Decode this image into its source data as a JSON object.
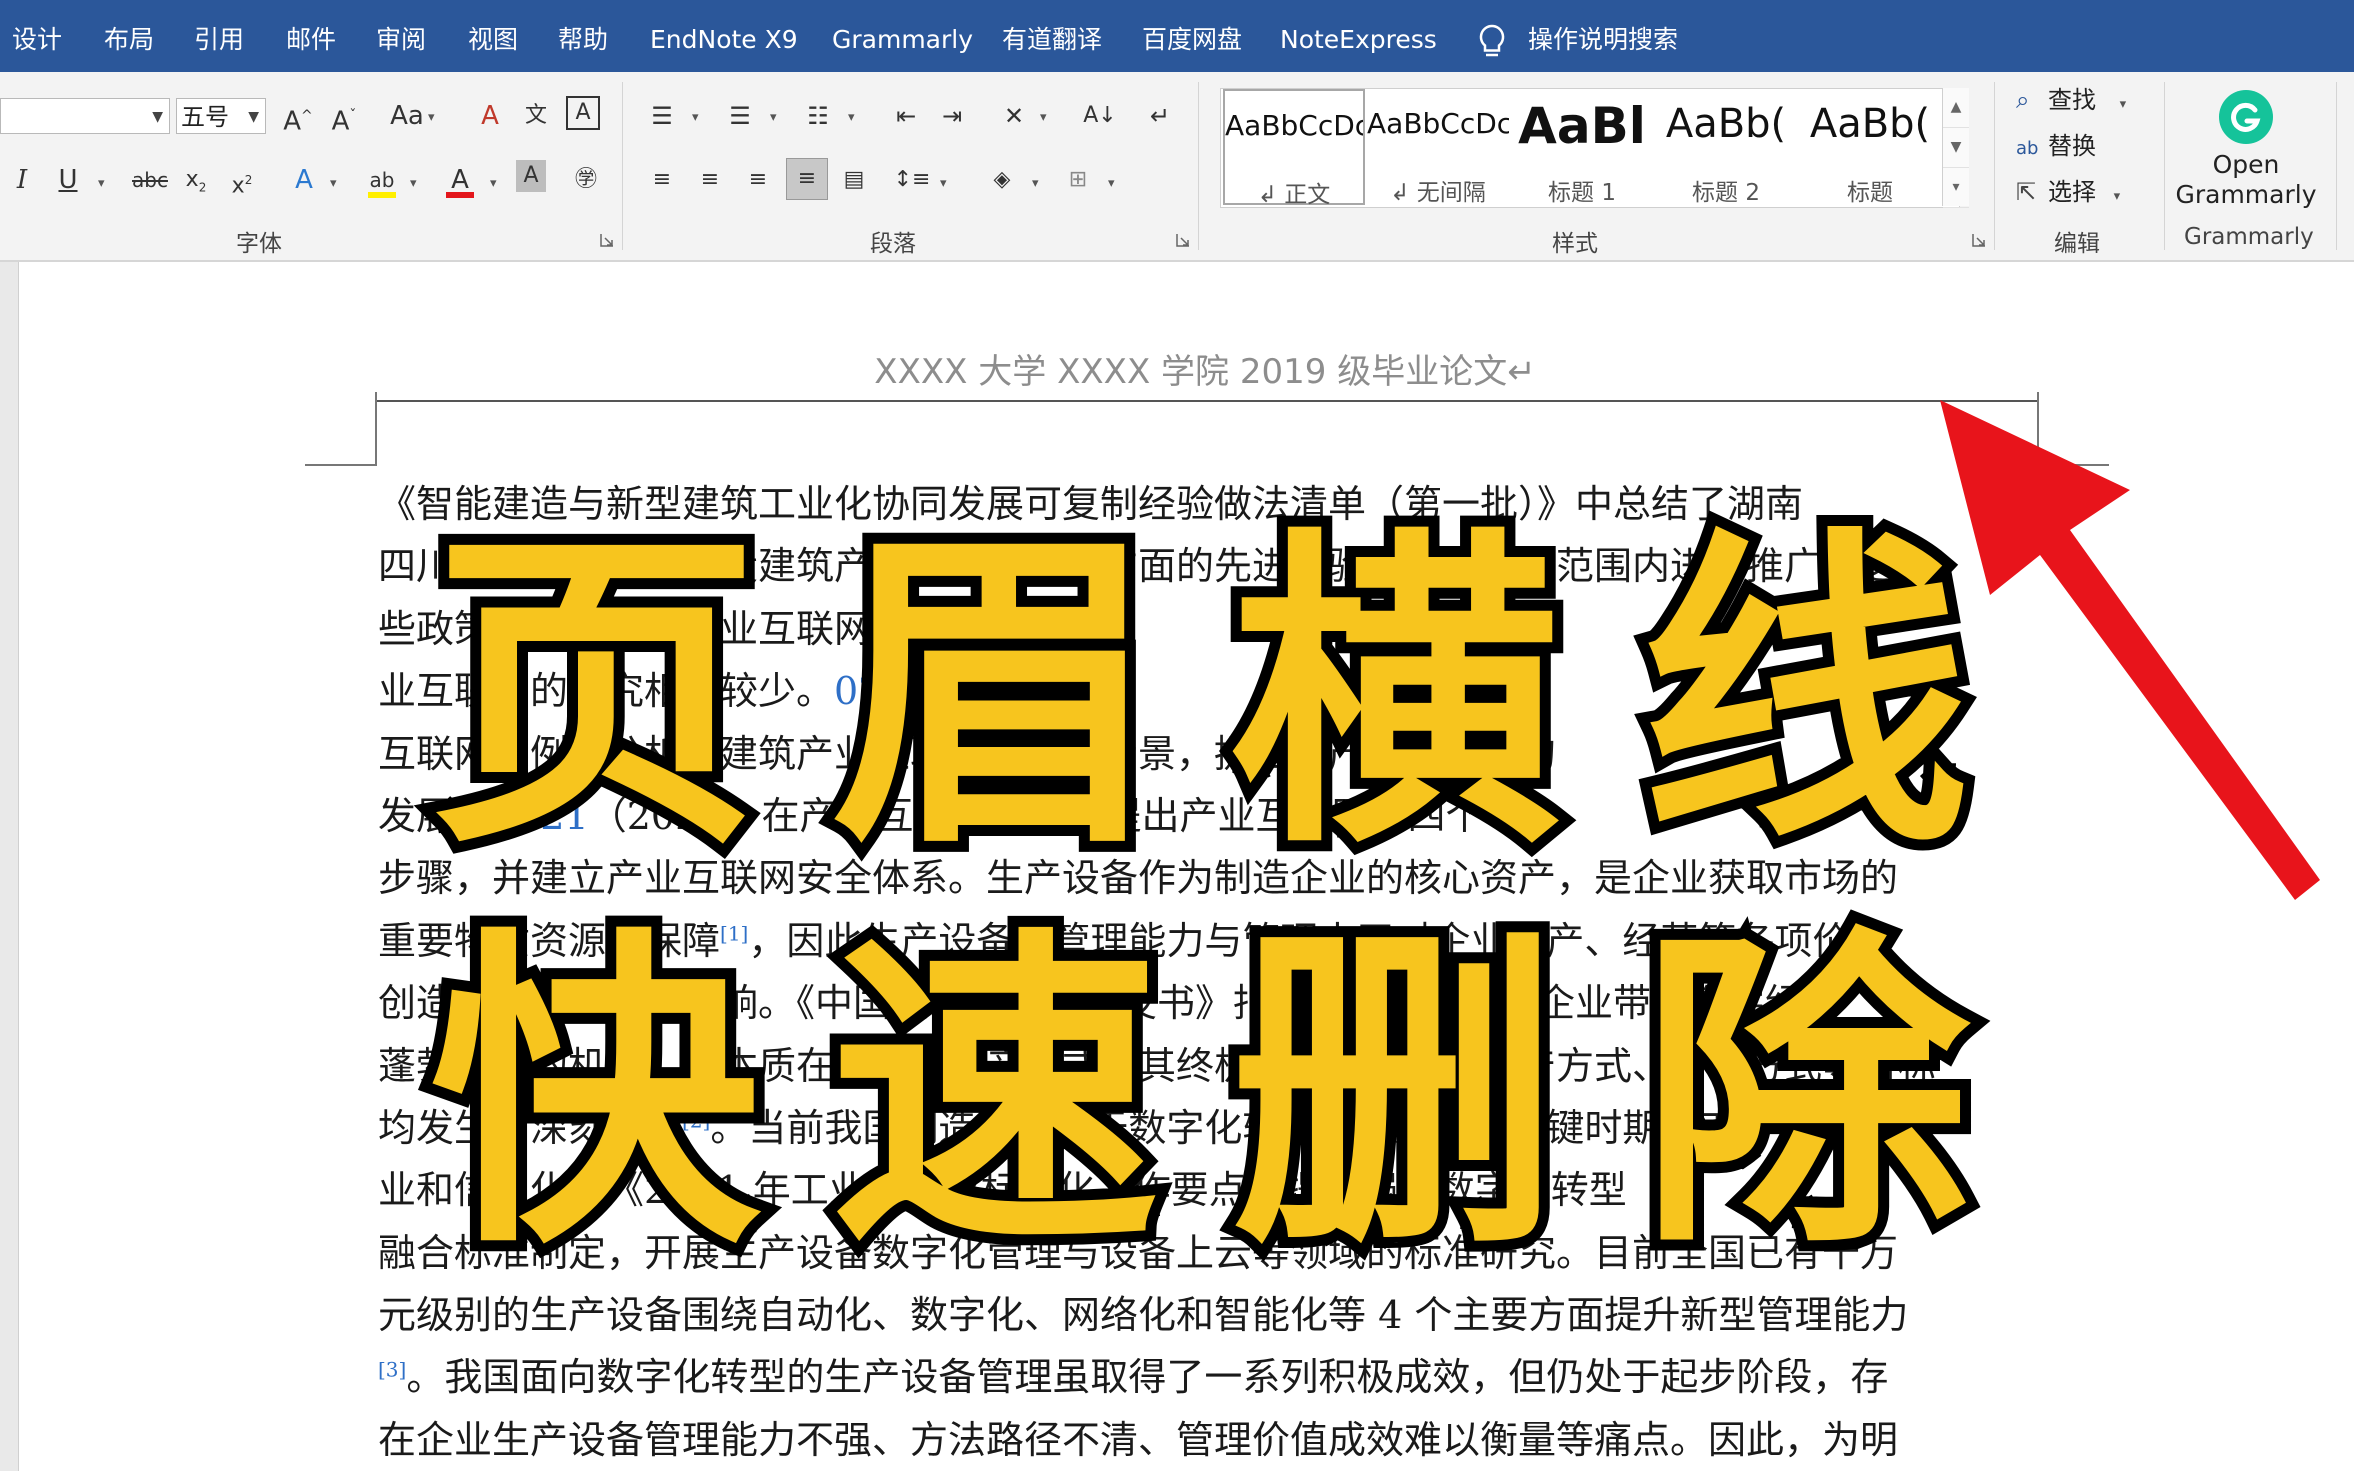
{
  "menu": {
    "items": [
      "设计",
      "布局",
      "引用",
      "邮件",
      "审阅",
      "视图",
      "帮助",
      "EndNote X9",
      "Grammarly",
      "有道翻译",
      "百度网盘",
      "NoteExpress"
    ],
    "search_label": "操作说明搜索"
  },
  "ribbon": {
    "font_name": "",
    "font_size": "五号",
    "groups": {
      "font": "字体",
      "paragraph": "段落",
      "styles": "样式",
      "editing": "编辑",
      "grammarly": "Grammarly"
    },
    "styles": [
      {
        "sample": "AaBbCcDc",
        "name": "正文",
        "mark": "↲"
      },
      {
        "sample": "AaBbCcDc",
        "name": "无间隔",
        "mark": "↲"
      },
      {
        "sample": "AaBl",
        "name": "标题 1"
      },
      {
        "sample": "AaBb(",
        "name": "标题 2"
      },
      {
        "sample": "AaBb(",
        "name": "标题"
      }
    ],
    "editing": {
      "find": "查找",
      "replace": "替换",
      "select": "选择"
    },
    "grammarly": {
      "open_line1": "Open",
      "open_line2": "Grammarly"
    }
  },
  "colors": {
    "menubar": "#2b579a",
    "overlay_fill": "#f7c51e",
    "arrow": "#e8141b",
    "link": "#2e6fc7"
  },
  "document": {
    "header": "XXXX 大学 XXXX 学院 2019 级毕业论文↵",
    "lines": [
      [
        "《智能建造与新型建筑工业化协同发展可复制经验做法清单（第一批）》中总结了湖南"
      ],
      [
        "四川省、广东省在建设建筑产业互联网平台方面的先进经验，并在全国范围内进行推广，这"
      ],
      [
        "些政策为我国建筑产业互联网平台的建设按"
      ],
      [
        "业互联网的研究相对较少。",
        {
          "link": "020"
        },
        "）从"
      ],
      [
        "互联网为例，分析了建筑产业互联网的应用场景，提出了产业互联网的"
      ],
      [
        "发展",
        {
          "link": "（2021"
        },
        "（2021）在产业互联网发展中提出产业互联网的四个"
      ],
      [
        "步骤，并建立产业互联网安全体系。生产设备作为制造企业的核心资产，是企业获取市场的"
      ],
      [
        "重要物质资源与保障",
        {
          "sup": "[1]"
        },
        "，因此生产设备的管理能力与管理水平对企业生产、经营等各项价值"
      ],
      [
        "创造活动具有重要影响。《中国数字化转型白皮书》指出数字化转型为企业带来数字经济"
      ],
      [
        "蓬勃发展的机遇，其本质在于转变生产方式，其终极目的在于转变生产方式、管理方式等目标"
      ],
      [
        "均发生了深刻变化",
        {
          "sup": "[2]"
        },
        "。当前我国制造业正处于数字化转型步伐加快的关键时期，工"
      ],
      [
        "业和信息化部《2021 年工业通信业标准化工作要点》提出强化数字化转型"
      ],
      [
        "融合标准制定，开展生产设备数字化管理与设备上云等领域的标准研究。目前全国已有千万"
      ],
      [
        "元级别的生产设备围绕自动化、数字化、网络化和智能化等 4 个主要方面提升新型管理能力"
      ],
      [
        {
          "sup": "[3]"
        },
        "。我国面向数字化转型的生产设备管理虽取得了一系列积极成效，但仍处于起步阶段，存"
      ],
      [
        "在企业生产设备管理能力不强、方法路径不清、管理价值成效难以衡量等痛点。因此，为明"
      ]
    ]
  },
  "overlay": {
    "line1": [
      "页",
      "眉",
      "横",
      "线"
    ],
    "line2": [
      "快",
      "速",
      "删",
      "除"
    ]
  }
}
